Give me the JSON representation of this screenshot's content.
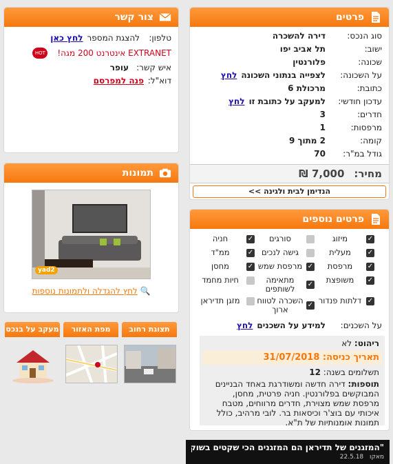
{
  "details": {
    "title": "פרטים",
    "rows": [
      {
        "label": "סוג הנכס:",
        "value": "דירה להשכרה"
      },
      {
        "label": "ישוב:",
        "value": "תל אביב יפו"
      },
      {
        "label": "שכונה:",
        "value": "פלורנטין"
      },
      {
        "label": "על השכונה:",
        "value": "לצפייה בנתוני השכונה",
        "link": "לחץ"
      },
      {
        "label": "כתובת:",
        "value": "מרכולת 6"
      },
      {
        "label": "עדכון חודשי:",
        "value": "למעקב על כתובת זו",
        "link": "לחץ"
      },
      {
        "label": "חדרים:",
        "value": "3"
      },
      {
        "label": "מרפסות:",
        "value": "1"
      },
      {
        "label": "קומה:",
        "value": "2 מתוך 9"
      },
      {
        "label": "גודל במ\"ר:",
        "value": "70"
      }
    ],
    "price_label": "מחיר:",
    "price_value": "7,000 ₪",
    "promo_button": "הנדימן לבית ולגינה >>"
  },
  "contact": {
    "title": "צור קשר",
    "phone_label": "טלפון:",
    "phone_text": "להצגת המספר",
    "phone_link": "לחץ כאן",
    "promo": "EXTRANET אינטרנט 200 מגה!",
    "person_label": "איש קשר:",
    "person_value": "עופר",
    "email_label": "דוא\"ל:",
    "email_link": "פנה למפרסם"
  },
  "photos": {
    "title": "תמונות",
    "watermark": "yad2",
    "enlarge_link": "לחץ להגדלה ולתמונות נוספות"
  },
  "tabs": [
    "תצוגת רחוב",
    "מפת האזור",
    "מעקב על בנכס"
  ],
  "extra": {
    "title": "פרטים נוספים",
    "features": [
      {
        "label": "מיזוג",
        "on": true
      },
      {
        "label": "סורגים",
        "on": false
      },
      {
        "label": "חניה",
        "on": true
      },
      {
        "label": "מעלית",
        "on": true
      },
      {
        "label": "גישה לנכים",
        "on": false
      },
      {
        "label": "ממ\"ד",
        "on": true
      },
      {
        "label": "מרפסת",
        "on": true
      },
      {
        "label": "מרפסת שמש",
        "on": true
      },
      {
        "label": "מחסן",
        "on": true
      },
      {
        "label": "משופצת",
        "on": true
      },
      {
        "label": "מתאימה לשותפים",
        "on": true
      },
      {
        "label": "חיות מחמד",
        "on": false
      },
      {
        "label": "דלתות פנדור",
        "on": true
      },
      {
        "label": "השכרה לטווח ארוך",
        "on": true
      },
      {
        "label": "מזגן תדיראן",
        "on": false
      }
    ],
    "neighbors_label": "על השכנים:",
    "neighbors_text": "למידע על השכנים",
    "neighbors_link": "לחץ",
    "furniture_label": "ריהוט:",
    "furniture_value": "לא",
    "entry_label": "תאריך כניסה:",
    "entry_value": "31/07/2018",
    "payments_label": "תשלומים בשנה:",
    "payments_value": "12",
    "more_label": "תוספות:",
    "more_value": "דירה חדשה ומשודרגת באחד הבניינים המבוקשים בפלורנטין. חניה פרטית, מחסן, מרפסת שמש מצוירת, חדרים מרווחים, מטבח איכותי עם בוצ'ר וכיסאות בר. לובי מרהיב, כולל תמונות אומנותיות של ת\"א."
  },
  "banner": {
    "headline": "\"המזגנים של תדיראן הם המזגנים הכי שקטים בשוק\"",
    "source": "מאקו",
    "date": "22.5.18"
  }
}
